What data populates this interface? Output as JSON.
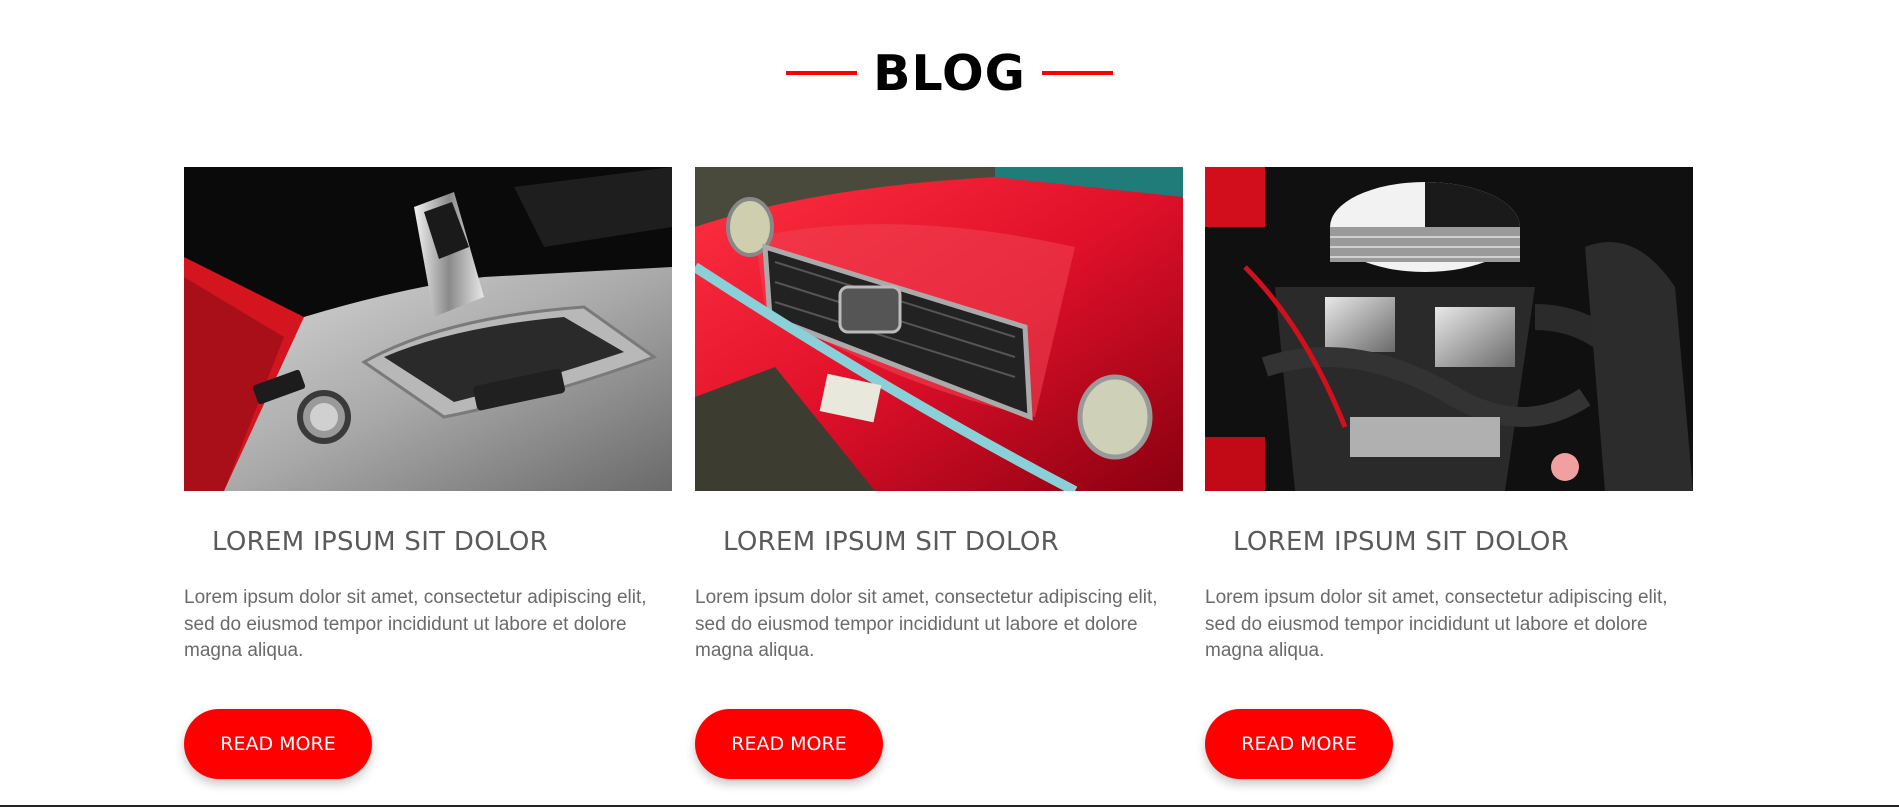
{
  "section": {
    "title": "BLOG",
    "accent_color": "#ff0000"
  },
  "posts": [
    {
      "image": "gear-shifter-photo",
      "title": "LOREM IPSUM SIT DOLOR",
      "excerpt": "Lorem ipsum dolor sit amet, consectetur adipiscing elit, sed do eiusmod tempor incididunt ut labore et dolore magna aliqua.",
      "button": "READ MORE"
    },
    {
      "image": "red-mustang-photo",
      "title": "LOREM IPSUM SIT DOLOR",
      "excerpt": "Lorem ipsum dolor sit amet, consectetur adipiscing elit, sed do eiusmod tempor incididunt ut labore et dolore magna aliqua.",
      "button": "READ MORE"
    },
    {
      "image": "engine-bay-photo",
      "title": "LOREM IPSUM SIT DOLOR",
      "excerpt": "Lorem ipsum dolor sit amet, consectetur adipiscing elit, sed do eiusmod tempor incididunt ut labore et dolore magna aliqua.",
      "button": "READ MORE"
    }
  ]
}
